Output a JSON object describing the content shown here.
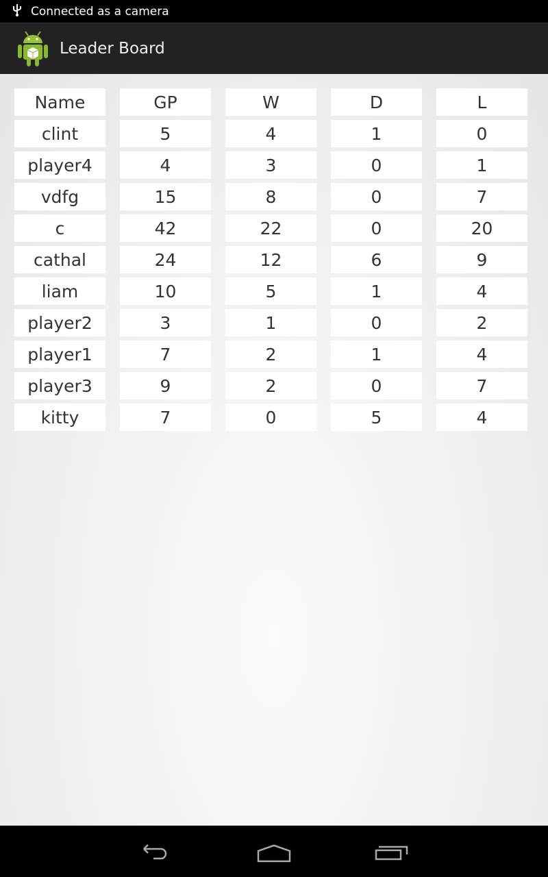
{
  "status_bar": {
    "notification": "Connected as a camera",
    "icon": "usb-icon"
  },
  "action_bar": {
    "title": "Leader Board",
    "icon": "android-app-icon"
  },
  "table": {
    "headers": [
      "Name",
      "GP",
      "W",
      "D",
      "L"
    ],
    "rows": [
      [
        "clint",
        "5",
        "4",
        "1",
        "0"
      ],
      [
        "player4",
        "4",
        "3",
        "0",
        "1"
      ],
      [
        "vdfg",
        "15",
        "8",
        "0",
        "7"
      ],
      [
        "c",
        "42",
        "22",
        "0",
        "20"
      ],
      [
        "cathal",
        "24",
        "12",
        "6",
        "9"
      ],
      [
        "liam",
        "10",
        "5",
        "1",
        "4"
      ],
      [
        "player2",
        "3",
        "1",
        "0",
        "2"
      ],
      [
        "player1",
        "7",
        "2",
        "1",
        "4"
      ],
      [
        "player3",
        "9",
        "2",
        "0",
        "7"
      ],
      [
        "kitty",
        "7",
        "0",
        "5",
        "4"
      ]
    ]
  },
  "nav_bar": {
    "buttons": [
      "back-icon",
      "home-icon",
      "recent-apps-icon"
    ]
  }
}
